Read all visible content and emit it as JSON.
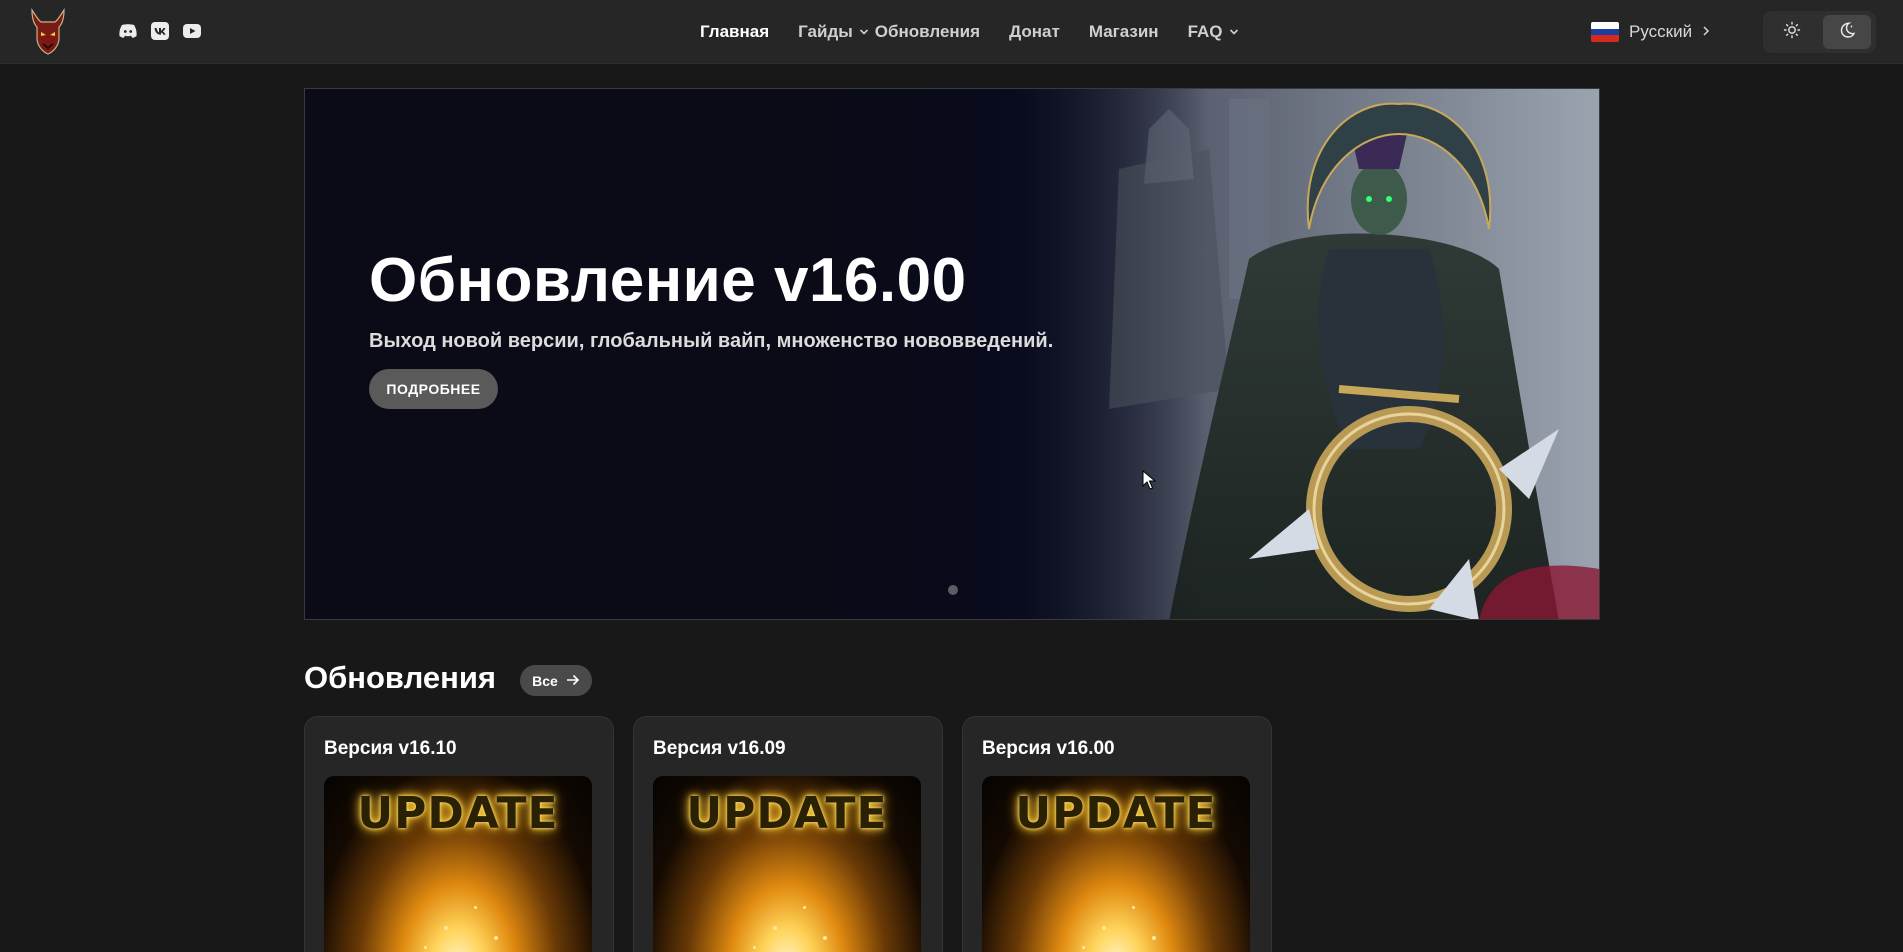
{
  "header": {
    "socials": [
      {
        "icon": "discord-icon"
      },
      {
        "icon": "vk-icon"
      },
      {
        "icon": "youtube-icon"
      }
    ],
    "nav": [
      {
        "label": "Главная",
        "active": true,
        "dropdown": false
      },
      {
        "label": "Гайды",
        "active": false,
        "dropdown": true
      },
      {
        "label": "Обновления",
        "active": false,
        "dropdown": false
      },
      {
        "label": "Донат",
        "active": false,
        "dropdown": false
      },
      {
        "label": "Магазин",
        "active": false,
        "dropdown": false
      },
      {
        "label": "FAQ",
        "active": false,
        "dropdown": true
      }
    ],
    "language": {
      "label": "Русский",
      "flag": "russia-flag-icon"
    },
    "theme": {
      "light_icon": "sun-icon",
      "dark_icon": "moon-icon",
      "selected": "dark"
    }
  },
  "hero": {
    "title": "Обновление v16.00",
    "subtitle": "Выход новой версии, глобальный вайп, множенство нововведений.",
    "button_label": "ПОДРОБНЕЕ",
    "slides_count": 1,
    "active_slide": 1
  },
  "updates": {
    "title": "Обновления",
    "all_label": "Все",
    "cards": [
      {
        "title": "Версия v16.10",
        "image_text": "UPDATE"
      },
      {
        "title": "Версия v16.09",
        "image_text": "UPDATE"
      },
      {
        "title": "Версия v16.00",
        "image_text": "UPDATE"
      }
    ]
  },
  "colors": {
    "background": "#181818",
    "header": "#262626",
    "card": "#262626",
    "button": "#5a5a5a"
  }
}
